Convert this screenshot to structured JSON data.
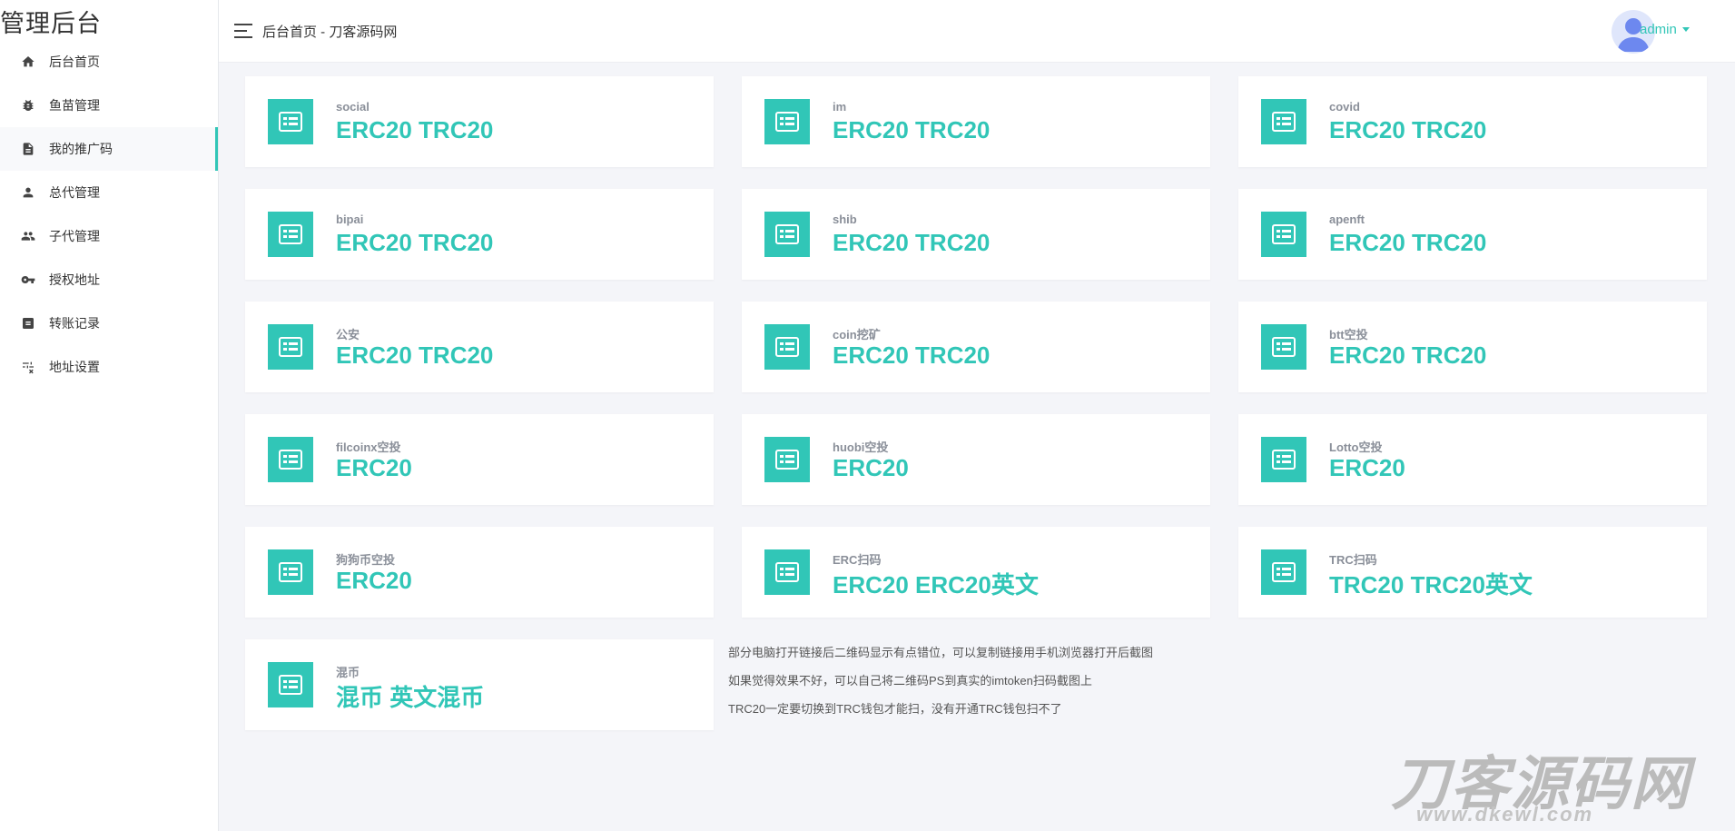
{
  "sidebar": {
    "brand": "管理后台",
    "items": [
      {
        "label": "后台首页",
        "icon": "home-icon"
      },
      {
        "label": "鱼苗管理",
        "icon": "bug-icon"
      },
      {
        "label": "我的推广码",
        "icon": "document-icon"
      },
      {
        "label": "总代管理",
        "icon": "person-icon"
      },
      {
        "label": "子代管理",
        "icon": "people-icon"
      },
      {
        "label": "授权地址",
        "icon": "key-icon"
      },
      {
        "label": "转账记录",
        "icon": "list-icon"
      },
      {
        "label": "地址设置",
        "icon": "settings-icon"
      }
    ]
  },
  "header": {
    "breadcrumb": "后台首页 - 刀客源码网",
    "username": "admin"
  },
  "cards": [
    {
      "name": "social",
      "value": "ERC20 TRC20"
    },
    {
      "name": "im",
      "value": "ERC20 TRC20"
    },
    {
      "name": "covid",
      "value": "ERC20 TRC20"
    },
    {
      "name": "bipai",
      "value": "ERC20 TRC20"
    },
    {
      "name": "shib",
      "value": "ERC20 TRC20"
    },
    {
      "name": "apenft",
      "value": "ERC20 TRC20"
    },
    {
      "name": "公安",
      "value": "ERC20 TRC20"
    },
    {
      "name": "coin挖矿",
      "value": "ERC20 TRC20"
    },
    {
      "name": "btt空投",
      "value": "ERC20 TRC20"
    },
    {
      "name": "filcoinx空投",
      "value": "ERC20"
    },
    {
      "name": "huobi空投",
      "value": "ERC20"
    },
    {
      "name": "Lotto空投",
      "value": "ERC20"
    },
    {
      "name": "狗狗币空投",
      "value": "ERC20"
    },
    {
      "name": "ERC扫码",
      "value": "ERC20 ERC20英文"
    },
    {
      "name": "TRC扫码",
      "value": "TRC20 TRC20英文"
    },
    {
      "name": "混币",
      "value": "混币 英文混币"
    }
  ],
  "notes": [
    "部分电脑打开链接后二维码显示有点错位，可以复制链接用手机浏览器打开后截图",
    "如果觉得效果不好，可以自己将二维码PS到真实的imtoken扫码截图上",
    "TRC20一定要切换到TRC钱包才能扫，没有开通TRC钱包扫不了"
  ],
  "watermark": {
    "text": "刀客源码网",
    "sub": "www.dkewl.com"
  },
  "colors": {
    "accent": "#31c6b7",
    "background": "#f4f5f9",
    "label_gray": "#8a8f99"
  }
}
